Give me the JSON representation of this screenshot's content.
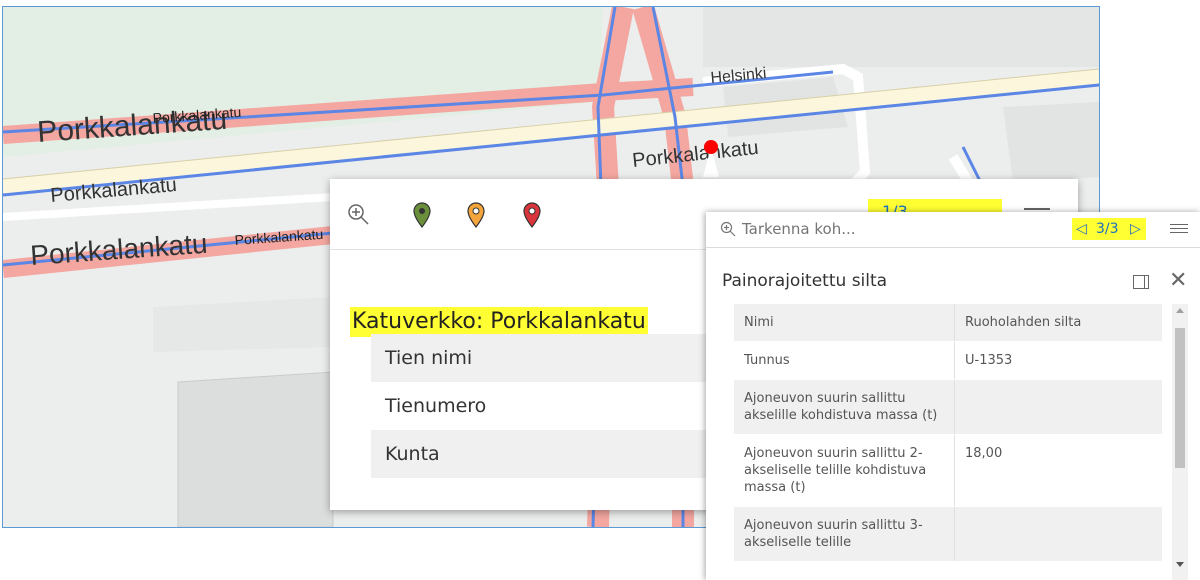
{
  "map": {
    "street_labels": [
      "Porkkalankatu",
      "Porkkalankatu",
      "Porkkalankatu",
      "Porkkalankatu",
      "Porkkalankatu",
      "Porkkalankatu",
      "Helsinki"
    ]
  },
  "popup_main": {
    "tools": [
      "zoom-in-icon",
      "green-marker-icon",
      "orange-marker-icon",
      "red-marker-icon"
    ],
    "pager": "1/3",
    "title": "Katuverkko: Porkkalankatu",
    "rows": [
      "Tien nimi",
      "Tienumero",
      "Kunta"
    ]
  },
  "popup_detail": {
    "search_placeholder": "Tarkenna koh...",
    "pager": {
      "prev": "◁",
      "value": "3/3",
      "next": "▷"
    },
    "title": "Painorajoitettu silta",
    "rows": [
      {
        "key": "Nimi",
        "value": "Ruoholahden silta"
      },
      {
        "key": "Tunnus",
        "value": "U-1353"
      },
      {
        "key": "Ajoneuvon suurin sallittu akselille kohdistuva massa (t)",
        "value": ""
      },
      {
        "key": "Ajoneuvon suurin sallittu 2-akseliselle telille kohdistuva massa (t)",
        "value": "18,00"
      },
      {
        "key": "Ajoneuvon suurin sallittu 3-akseliselle telille",
        "value": ""
      }
    ]
  },
  "colors": {
    "highlight": "#ffff33",
    "road_pink": "#f4a7a0",
    "road_cream": "#fbf6dc",
    "selection_blue": "#5b86e5",
    "map_green": "#e3eee4",
    "map_grey": "#eceeee"
  }
}
